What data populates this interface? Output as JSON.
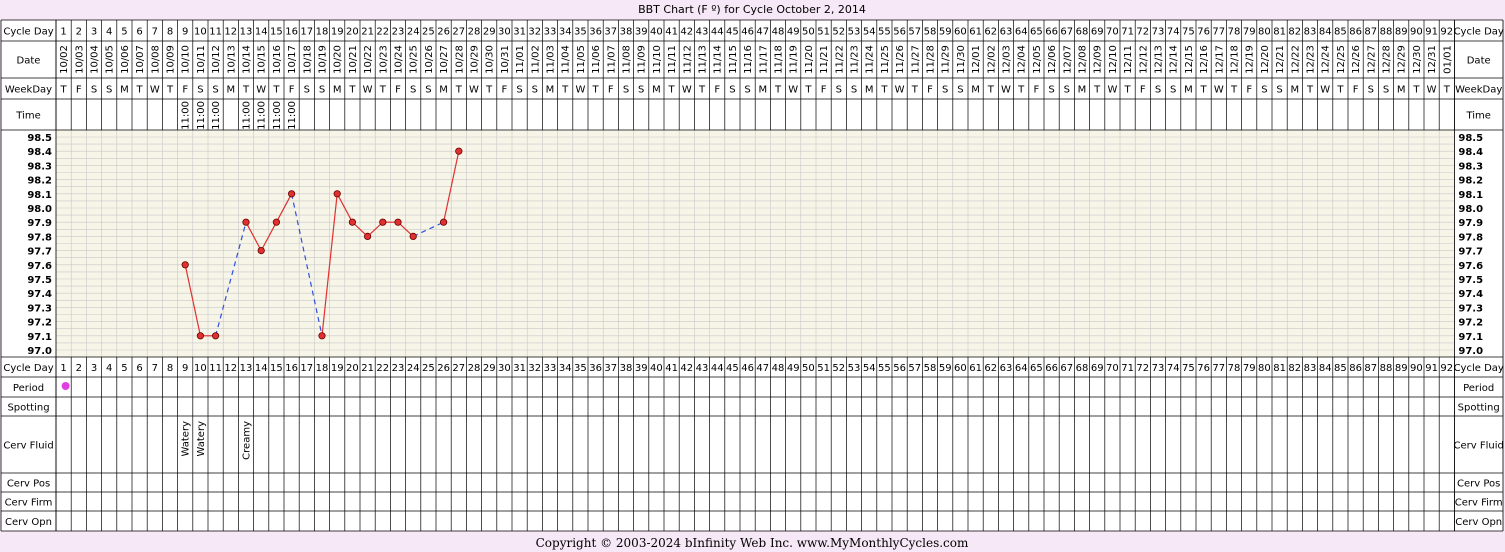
{
  "chart": {
    "title": "BBT Chart (F º) for Cycle October 2, 2014",
    "copyright": "Copyright © 2003-2024 bInfinity Web Inc.     www.MyMonthlyCycles.com",
    "row_labels": {
      "cycle_day": "Cycle Day",
      "date": "Date",
      "weekday": "WeekDay",
      "time": "Time",
      "period": "Period",
      "spotting": "Spotting",
      "cerv_fluid": "Cerv Fluid",
      "cerv_pos": "Cerv Pos",
      "cerv_firm": "Cerv Firm",
      "cerv_opn": "Cerv Opn"
    },
    "colors": {
      "background": "#f6e8f6",
      "plot_bg": "#f7f5e8",
      "grid": "#c8c8c8",
      "line": "#e03030",
      "dashed": "#3050e0",
      "period_dot": "#e040e0"
    }
  },
  "chart_data": {
    "type": "line",
    "title": "BBT Chart (F º) for Cycle October 2, 2014",
    "ylim": [
      97.0,
      98.5
    ],
    "y_ticks": [
      "98.5",
      "98.4",
      "98.3",
      "98.2",
      "98.1",
      "98.0",
      "97.9",
      "97.8",
      "97.7",
      "97.6",
      "97.5",
      "97.4",
      "97.3",
      "97.2",
      "97.1",
      "97.0"
    ],
    "days": [
      "1",
      "2",
      "3",
      "4",
      "5",
      "6",
      "7",
      "8",
      "9",
      "10",
      "11",
      "12",
      "13",
      "14",
      "15",
      "16",
      "17",
      "18",
      "19",
      "20",
      "21",
      "22",
      "23",
      "24",
      "25",
      "26",
      "27",
      "28",
      "29",
      "30",
      "31",
      "32",
      "33",
      "34",
      "35",
      "36",
      "37",
      "38",
      "39",
      "40",
      "41",
      "42",
      "43",
      "44",
      "45",
      "46",
      "47",
      "48",
      "49",
      "50",
      "51",
      "52",
      "53",
      "54",
      "55",
      "56",
      "57",
      "58",
      "59",
      "60",
      "61",
      "62",
      "63",
      "64",
      "65",
      "66",
      "67",
      "68",
      "69",
      "70",
      "71",
      "72",
      "73",
      "74",
      "75",
      "76",
      "77",
      "78",
      "79",
      "80",
      "81",
      "82",
      "83",
      "84",
      "85",
      "86",
      "87",
      "88",
      "89",
      "90",
      "91",
      "92"
    ],
    "dates": [
      "10/02",
      "10/03",
      "10/04",
      "10/05",
      "10/06",
      "10/07",
      "10/08",
      "10/09",
      "10/10",
      "10/11",
      "10/12",
      "10/13",
      "10/14",
      "10/15",
      "10/16",
      "10/17",
      "10/18",
      "10/19",
      "10/20",
      "10/21",
      "10/22",
      "10/23",
      "10/24",
      "10/25",
      "10/26",
      "10/27",
      "10/28",
      "10/29",
      "10/30",
      "10/31",
      "11/01",
      "11/02",
      "11/03",
      "11/04",
      "11/05",
      "11/06",
      "11/07",
      "11/08",
      "11/09",
      "11/10",
      "11/11",
      "11/12",
      "11/13",
      "11/14",
      "11/15",
      "11/16",
      "11/17",
      "11/18",
      "11/19",
      "11/20",
      "11/21",
      "11/22",
      "11/23",
      "11/24",
      "11/25",
      "11/26",
      "11/27",
      "11/28",
      "11/29",
      "11/30",
      "12/01",
      "12/02",
      "12/03",
      "12/04",
      "12/05",
      "12/06",
      "12/07",
      "12/08",
      "12/09",
      "12/10",
      "12/11",
      "12/12",
      "12/13",
      "12/14",
      "12/15",
      "12/16",
      "12/17",
      "12/18",
      "12/19",
      "12/20",
      "12/21",
      "12/22",
      "12/23",
      "12/24",
      "12/25",
      "12/26",
      "12/27",
      "12/28",
      "12/29",
      "12/30",
      "12/31",
      "01/01"
    ],
    "weekdays": [
      "T",
      "F",
      "S",
      "S",
      "M",
      "T",
      "W",
      "T",
      "F",
      "S",
      "S",
      "M",
      "T",
      "W",
      "T",
      "F",
      "S",
      "S",
      "M",
      "T",
      "W",
      "T",
      "F",
      "S",
      "S",
      "M",
      "T",
      "W",
      "T",
      "F",
      "S",
      "S",
      "M",
      "T",
      "W",
      "T",
      "F",
      "S",
      "S",
      "M",
      "T",
      "W",
      "T",
      "F",
      "S",
      "S",
      "M",
      "T",
      "W",
      "T",
      "F",
      "S",
      "S",
      "M",
      "T",
      "W",
      "T",
      "F",
      "S",
      "S",
      "M",
      "T",
      "W",
      "T",
      "F",
      "S",
      "S",
      "M",
      "T",
      "W",
      "T",
      "F",
      "S",
      "S",
      "M",
      "T",
      "W",
      "T",
      "F",
      "S",
      "S",
      "M",
      "T",
      "W",
      "T",
      "F",
      "S",
      "S",
      "M",
      "T",
      "W",
      "T"
    ],
    "times": [
      {
        "day": 9,
        "value": "11:00"
      },
      {
        "day": 10,
        "value": "11:00"
      },
      {
        "day": 11,
        "value": "11:00"
      },
      {
        "day": 13,
        "value": "11:00"
      },
      {
        "day": 14,
        "value": "11:00"
      },
      {
        "day": 15,
        "value": "11:00"
      },
      {
        "day": 16,
        "value": "11:00"
      }
    ],
    "temperatures": [
      {
        "day": 9,
        "value": 97.6
      },
      {
        "day": 10,
        "value": 97.1
      },
      {
        "day": 11,
        "value": 97.1
      },
      {
        "day": 13,
        "value": 97.9
      },
      {
        "day": 14,
        "value": 97.7
      },
      {
        "day": 15,
        "value": 97.9
      },
      {
        "day": 16,
        "value": 98.1
      },
      {
        "day": 18,
        "value": 97.1
      },
      {
        "day": 19,
        "value": 98.1
      },
      {
        "day": 20,
        "value": 97.9
      },
      {
        "day": 21,
        "value": 97.8
      },
      {
        "day": 22,
        "value": 97.9
      },
      {
        "day": 23,
        "value": 97.9
      },
      {
        "day": 24,
        "value": 97.8
      },
      {
        "day": 26,
        "value": 97.9
      },
      {
        "day": 27,
        "value": 98.4
      }
    ],
    "period": [
      1
    ],
    "cerv_fluid": [
      {
        "day": 9,
        "value": "Watery"
      },
      {
        "day": 10,
        "value": "Watery"
      },
      {
        "day": 13,
        "value": "Creamy"
      }
    ]
  }
}
